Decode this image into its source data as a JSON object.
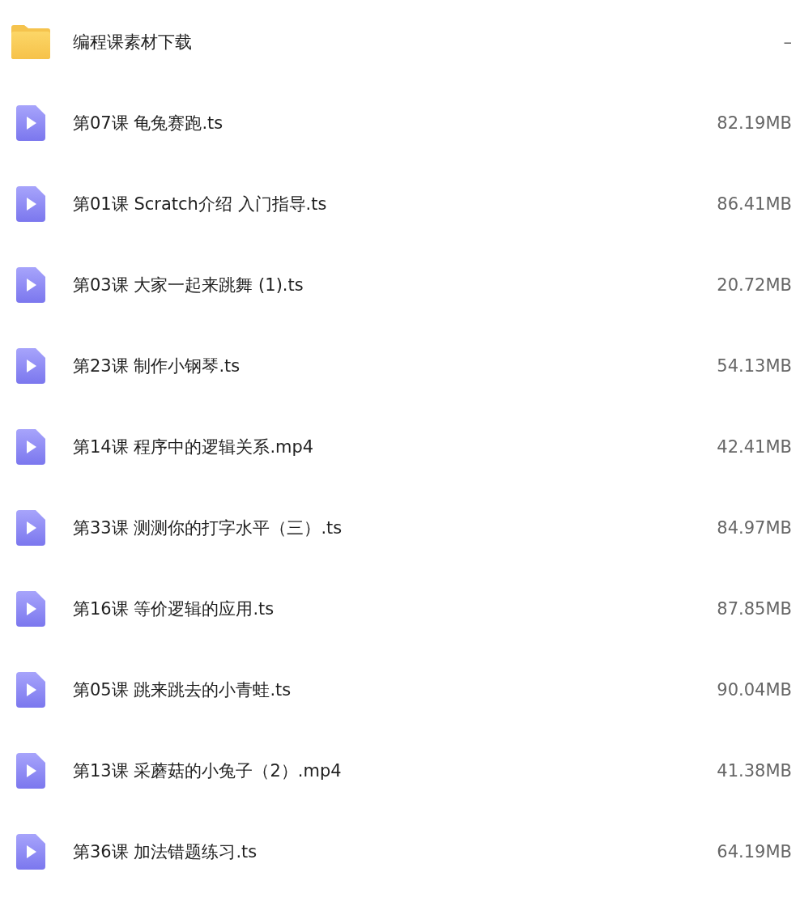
{
  "files": [
    {
      "kind": "folder",
      "name": "编程课素材下载",
      "size": "–"
    },
    {
      "kind": "video",
      "name": "第07课 龟兔赛跑.ts",
      "size": "82.19MB"
    },
    {
      "kind": "video",
      "name": "第01课 Scratch介绍 入门指导.ts",
      "size": "86.41MB"
    },
    {
      "kind": "video",
      "name": "第03课 大家一起来跳舞 (1).ts",
      "size": "20.72MB"
    },
    {
      "kind": "video",
      "name": "第23课 制作小钢琴.ts",
      "size": "54.13MB"
    },
    {
      "kind": "video",
      "name": "第14课 程序中的逻辑关系.mp4",
      "size": "42.41MB"
    },
    {
      "kind": "video",
      "name": "第33课 测测你的打字水平（三）.ts",
      "size": "84.97MB"
    },
    {
      "kind": "video",
      "name": "第16课 等价逻辑的应用.ts",
      "size": "87.85MB"
    },
    {
      "kind": "video",
      "name": "第05课 跳来跳去的小青蛙.ts",
      "size": "90.04MB"
    },
    {
      "kind": "video",
      "name": "第13课 采蘑菇的小兔子（2）.mp4",
      "size": "41.38MB"
    },
    {
      "kind": "video",
      "name": "第36课 加法错题练习.ts",
      "size": "64.19MB"
    }
  ]
}
